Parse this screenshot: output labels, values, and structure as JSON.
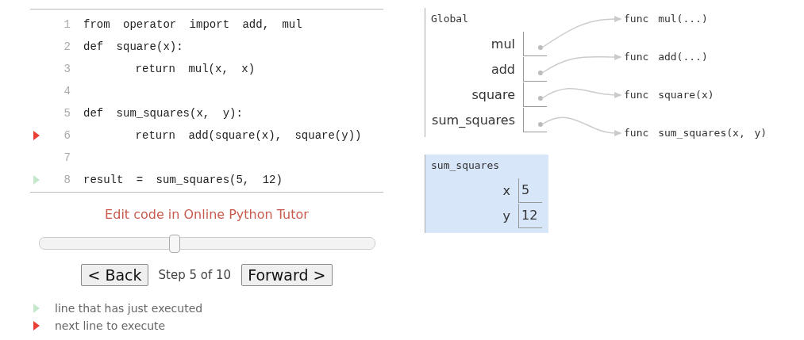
{
  "code": {
    "lines": [
      {
        "number": "1",
        "text": "from operator import add, mul",
        "next": false,
        "executed": false
      },
      {
        "number": "2",
        "text": "def square(x):",
        "next": false,
        "executed": false
      },
      {
        "number": "3",
        "text": "    return mul(x, x)",
        "next": false,
        "executed": false
      },
      {
        "number": "4",
        "next": false,
        "executed": false
      },
      {
        "number": "5",
        "text": "def sum_squares(x, y):",
        "next": false,
        "executed": false
      },
      {
        "number": "6",
        "text": "    return add(square(x), square(y))",
        "next": true,
        "executed": false
      },
      {
        "number": "7",
        "next": false,
        "executed": false
      },
      {
        "number": "8",
        "text": "result = sum_squares(5, 12)",
        "next": false,
        "executed": true
      }
    ]
  },
  "edit_link": "Edit code in Online Python Tutor",
  "slider": {
    "level": 0.4
  },
  "navigation": {
    "back": "< Back",
    "step": "Step 5 of 10",
    "forward": "Forward >"
  },
  "legend": [
    {
      "kind": "executed",
      "text": "line that has just executed"
    },
    {
      "kind": "next",
      "text": "next line to execute"
    }
  ],
  "frames": [
    {
      "title": "Global",
      "active": false,
      "variables": [
        {
          "name": "mul",
          "kind": "pointer"
        },
        {
          "name": "add",
          "kind": "pointer"
        },
        {
          "name": "square",
          "kind": "pointer"
        },
        {
          "name": "sum_squares",
          "kind": "pointer"
        }
      ]
    },
    {
      "title": "sum_squares",
      "active": true,
      "variables": [
        {
          "name": "x",
          "kind": "value",
          "value": "5"
        },
        {
          "name": "y",
          "kind": "value",
          "value": "12"
        }
      ]
    }
  ],
  "objects": [
    "func mul(...)",
    "func add(...)",
    "func square(x)",
    "func sum_squares(x, y)"
  ]
}
